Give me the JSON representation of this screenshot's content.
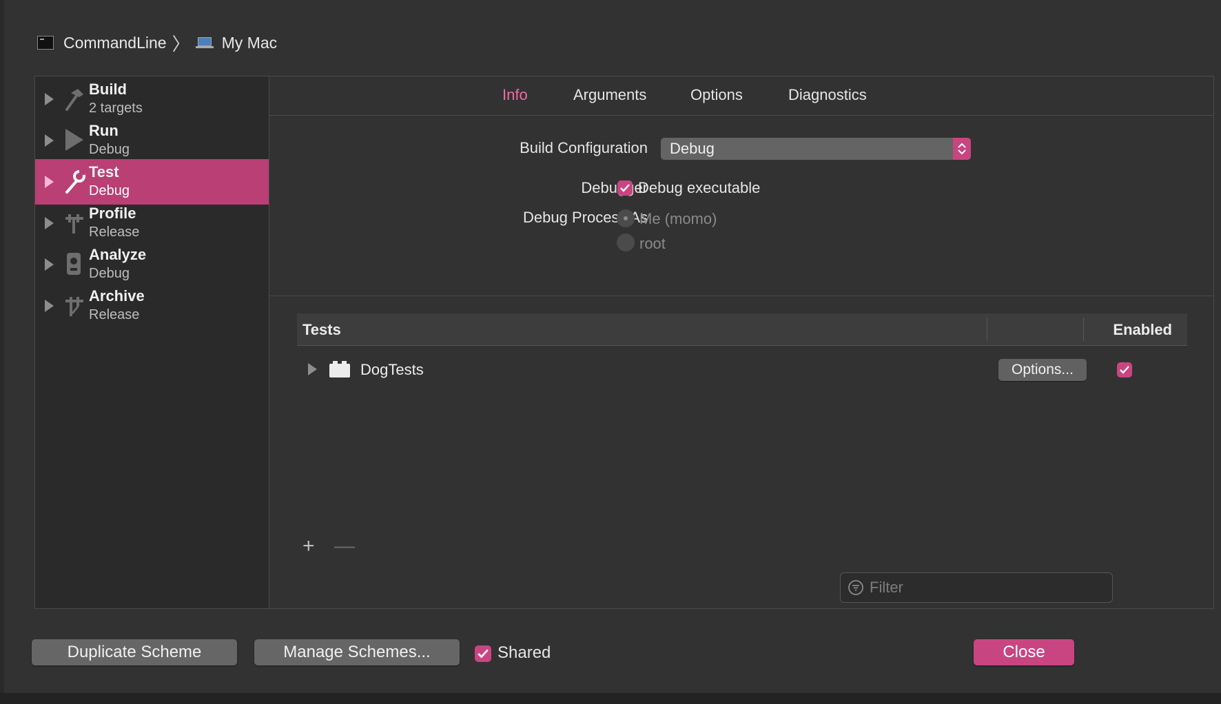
{
  "breadcrumb": {
    "project": "CommandLine",
    "separator": "〉",
    "destination": "My Mac"
  },
  "sidebar": {
    "items": [
      {
        "title": "Build",
        "subtitle": "2 targets",
        "icon": "hammer-icon"
      },
      {
        "title": "Run",
        "subtitle": "Debug",
        "icon": "play-icon"
      },
      {
        "title": "Test",
        "subtitle": "Debug",
        "icon": "wrench-icon",
        "selected": true
      },
      {
        "title": "Profile",
        "subtitle": "Release",
        "icon": "instruments-icon"
      },
      {
        "title": "Analyze",
        "subtitle": "Debug",
        "icon": "analyze-icon"
      },
      {
        "title": "Archive",
        "subtitle": "Release",
        "icon": "archive-icon"
      }
    ]
  },
  "tabs": [
    {
      "label": "Info",
      "active": true
    },
    {
      "label": "Arguments"
    },
    {
      "label": "Options"
    },
    {
      "label": "Diagnostics"
    }
  ],
  "info": {
    "build_configuration_label": "Build Configuration",
    "build_configuration_value": "Debug",
    "debugger_label": "Debugger",
    "debug_executable_label": "Debug executable",
    "debug_executable_checked": true,
    "debug_process_as_label": "Debug Process As",
    "process_options": [
      {
        "label": "Me (momo)",
        "selected": true
      },
      {
        "label": "root",
        "selected": false
      }
    ]
  },
  "tests_table": {
    "col_tests": "Tests",
    "col_enabled": "Enabled",
    "rows": [
      {
        "name": "DogTests",
        "options_label": "Options...",
        "enabled": true
      }
    ],
    "add_label": "+",
    "remove_label": "—",
    "filter_placeholder": "Filter"
  },
  "footer": {
    "duplicate_label": "Duplicate Scheme",
    "manage_label": "Manage Schemes...",
    "shared_label": "Shared",
    "shared_checked": true,
    "close_label": "Close"
  },
  "colors": {
    "accent": "#c94581",
    "selection": "#b93f74",
    "active_tab": "#f16aa6",
    "background": "#323232",
    "sidebar": "#2a2a2a"
  }
}
